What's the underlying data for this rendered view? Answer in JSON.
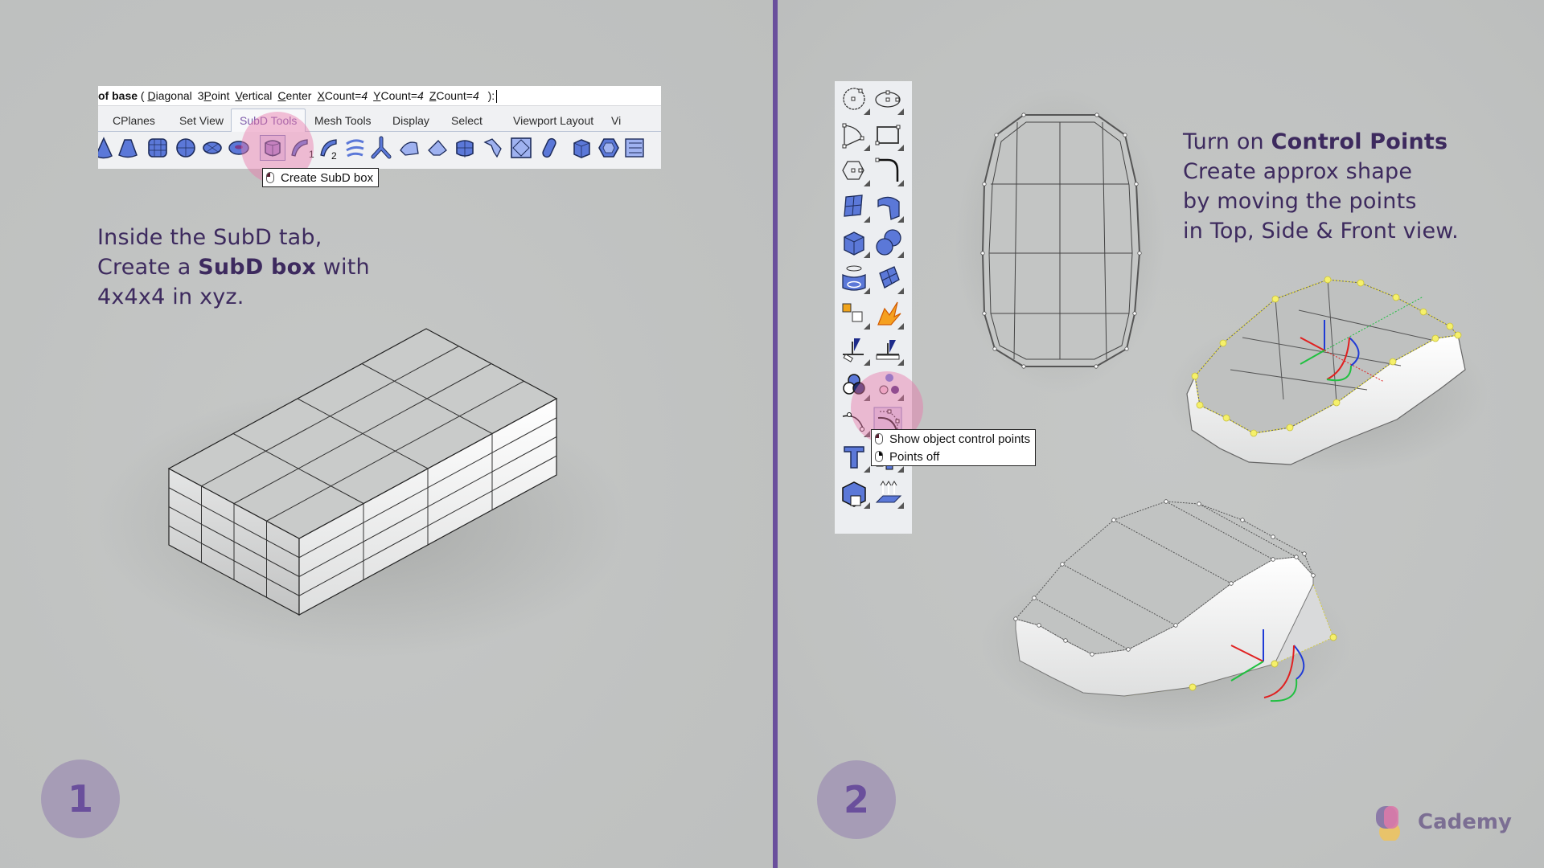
{
  "colors": {
    "background": "#c3c5c4",
    "divider": "#6a4f9c",
    "heading_text": "#3d2a5e",
    "badge_fill": "#a69cb6",
    "badge_text": "#6a4f9c",
    "highlight": "#e878aa",
    "active_tab": "#7d5aa9",
    "control_point": "#f5f06a"
  },
  "step1": {
    "command_line": {
      "prefix": "of base",
      "open_paren": " ( ",
      "options": [
        {
          "label": "Diagonal",
          "hotkey": "D",
          "rest": "iagonal"
        },
        {
          "label": "3Point",
          "pre": "3",
          "hotkey": "P",
          "rest": "oint"
        },
        {
          "label": "Vertical",
          "hotkey": "V",
          "rest": "ertical"
        },
        {
          "label": "Center",
          "hotkey": "C",
          "rest": "enter"
        },
        {
          "label": "XCount=4",
          "hotkey": "X",
          "rest": "Count=",
          "value": "4"
        },
        {
          "label": "YCount=4",
          "hotkey": "Y",
          "rest": "Count=",
          "value": "4"
        },
        {
          "label": "ZCount=4",
          "hotkey": "Z",
          "rest": "Count=",
          "value": "4"
        }
      ],
      "close": " ):"
    },
    "ribbon_tabs": [
      {
        "label": "CPlanes",
        "active": false
      },
      {
        "label": "Set View",
        "active": false
      },
      {
        "label": "SubD Tools",
        "active": true
      },
      {
        "label": "Mesh Tools",
        "active": false
      },
      {
        "label": "Display",
        "active": false
      },
      {
        "label": "Select",
        "active": false
      },
      {
        "label": "Viewport Layout",
        "active": false
      },
      {
        "label": "Vi",
        "active": false
      }
    ],
    "ribbon_icons": [
      "subd-cone-icon",
      "subd-truncated-cone-icon",
      "subd-cylinder-icon",
      "subd-sphere-icon",
      "subd-ellipsoid-icon",
      "subd-torus-icon",
      "create-subd-box-icon",
      "subd-rail-1-icon",
      "subd-rail-2-icon",
      "subd-loft-icon",
      "subd-tri-branch-icon",
      "subd-crease-icon",
      "subd-fold-icon",
      "subd-quad-box-icon",
      "subd-bridge-icon",
      "subd-control-frame-icon",
      "subd-capsule-icon",
      "subd-prism-icon",
      "subd-hexagon-icon",
      "subd-stack-icon"
    ],
    "rail_labels": [
      "1",
      "2"
    ],
    "selected_icon": "create-subd-box-icon",
    "tooltip": "Create SubD box",
    "instruction": {
      "line1": "Inside the SubD tab,",
      "line2_pre": "Create a ",
      "line2_bold": "SubD box",
      "line2_post": " with",
      "line3": "4x4x4 in xyz."
    },
    "model": {
      "type": "subd-box",
      "x_count": 4,
      "y_count": 4,
      "z_count": 4
    },
    "badge": "1"
  },
  "step2": {
    "toolbar_icons": [
      "circle-icon",
      "ellipse-icon",
      "arc-icon",
      "rectangle-icon",
      "polygon-icon",
      "fillet-curve-icon",
      "surface-from-points-icon",
      "extrude-surface-icon",
      "solid-box-icon",
      "boolean-union-icon",
      "cylinder-surface-icon",
      "mesh-surface-icon",
      "puzzle-join-icon",
      "explode-icon",
      "cplane-icon",
      "cplane-world-icon",
      "render-material-icon",
      "color-balls-icon",
      "curve-edit-icon",
      "show-control-points-icon",
      "text-icon",
      "group-array-icon",
      "block-icon",
      "extrude-arrows-icon"
    ],
    "selected_icon": "show-control-points-icon",
    "tooltip_rows": [
      {
        "mouse": "left",
        "label": "Show object control points"
      },
      {
        "mouse": "right",
        "label": "Points off"
      }
    ],
    "instruction": {
      "line1_pre": "Turn on ",
      "line1_bold": "Control Points",
      "line2": "Create approx shape",
      "line3": "by moving the points",
      "line4": "in Top, Side & Front view."
    },
    "views": [
      "top-view-model",
      "perspective-model-editing",
      "perspective-model-tail"
    ],
    "badge": "2"
  },
  "brand": {
    "name": "Cademy",
    "logo_colors": [
      "#8b7aa8",
      "#d97aa8",
      "#e8c36a"
    ]
  }
}
